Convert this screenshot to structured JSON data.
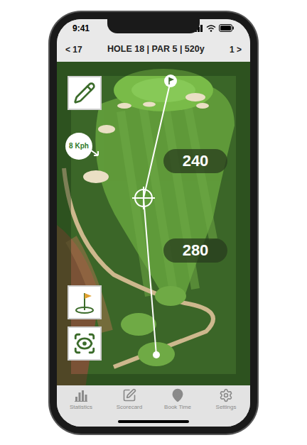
{
  "status_bar": {
    "time": "9:41"
  },
  "header": {
    "prev": "< 17",
    "title": "HOLE 18 | PAR 5 | 520y",
    "next": "1 >"
  },
  "map": {
    "wind": "8 Kph",
    "distances": [
      "240",
      "280"
    ]
  },
  "tabs": [
    {
      "label": "Statistics",
      "selected": false
    },
    {
      "label": "Scorecard",
      "selected": false
    },
    {
      "label": "Book Time",
      "selected": false
    },
    {
      "label": "Settings",
      "selected": false
    }
  ]
}
